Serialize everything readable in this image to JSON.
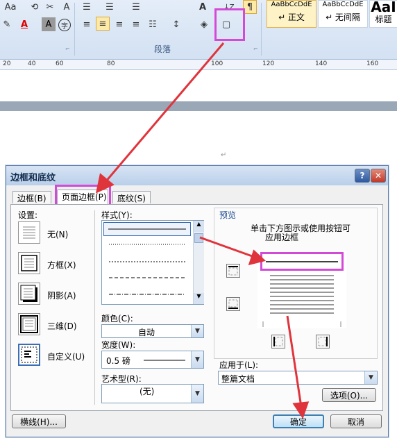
{
  "ribbon": {
    "font_buttons": [
      "Aa",
      "A",
      "A",
      "A"
    ],
    "group_label_paragraph": "段落",
    "styles": [
      {
        "preview": "AaBbCcDdE",
        "name": "↵ 正文"
      },
      {
        "preview": "AaBbCcDdE",
        "name": "↵ 无间隔"
      },
      {
        "preview": "AaI",
        "name": "标题"
      }
    ]
  },
  "ruler": {
    "ticks": [
      "20",
      "40",
      "60",
      "80",
      "100",
      "120",
      "140",
      "160"
    ]
  },
  "dialog": {
    "title": "边框和底纹",
    "help": "?",
    "close": "✕",
    "tabs": [
      "边框(B)",
      "页面边框(P)",
      "底纹(S)"
    ],
    "settings": {
      "label": "设置:",
      "items": [
        "无(N)",
        "方框(X)",
        "阴影(A)",
        "三维(D)",
        "自定义(U)"
      ]
    },
    "style": {
      "label": "样式(Y):"
    },
    "color": {
      "label": "颜色(C):",
      "value": "自动"
    },
    "width": {
      "label": "宽度(W):",
      "value": "0.5 磅"
    },
    "art": {
      "label": "艺术型(R):",
      "value": "(无)"
    },
    "preview": {
      "label": "预览",
      "hint_line1": "单击下方图示或使用按钮可",
      "hint_line2": "应用边框"
    },
    "apply_to": {
      "label": "应用于(L):",
      "value": "整篇文档"
    },
    "buttons": {
      "options": "选项(O)...",
      "horizontal_line": "横线(H)...",
      "ok": "确定",
      "cancel": "取消"
    }
  },
  "colors": {
    "highlight": "#d44ad8",
    "arrow": "#e0343c"
  }
}
